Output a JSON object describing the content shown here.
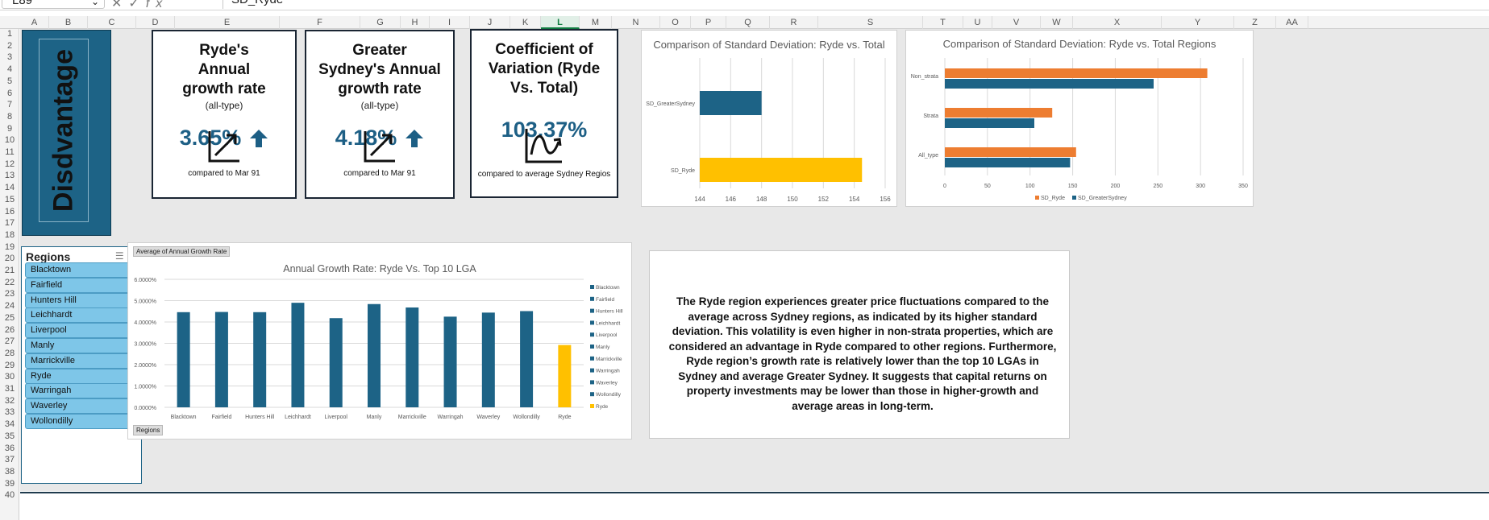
{
  "formula_bar": {
    "name_box": "L89",
    "fx": "fx",
    "formula": "SD_Ryde"
  },
  "columns": [
    "A",
    "B",
    "C",
    "D",
    "E",
    "F",
    "G",
    "H",
    "I",
    "J",
    "K",
    "L",
    "M",
    "N",
    "O",
    "P",
    "Q",
    "R",
    "S",
    "T",
    "U",
    "V",
    "W",
    "X",
    "Y",
    "Z",
    "AA"
  ],
  "active_column": "L",
  "rows": [
    "1",
    "2",
    "3",
    "4",
    "5",
    "6",
    "7",
    "8",
    "9",
    "10",
    "11",
    "12",
    "13",
    "14",
    "15",
    "16",
    "17",
    "18",
    "19",
    "20",
    "21",
    "22",
    "23",
    "24",
    "25",
    "26",
    "27",
    "28",
    "29",
    "30",
    "31",
    "32",
    "33",
    "34",
    "35",
    "36",
    "37",
    "38",
    "39",
    "40"
  ],
  "banner": {
    "text": "Disdvantage"
  },
  "cards": [
    {
      "title": "Ryde's Annual growth rate",
      "subtitle": "(all-type)",
      "value": "3.65%",
      "caption": "compared to Mar 91",
      "icon": "trend-up-icon",
      "arrow": "arrow-up-icon"
    },
    {
      "title": "Greater Sydney's Annual growth rate",
      "subtitle": "(all-type)",
      "value": "4.18%",
      "caption": "compared to Mar 91",
      "icon": "trend-up-icon",
      "arrow": "arrow-up-icon"
    },
    {
      "title": "Coefficient of Variation (Ryde Vs. Total)",
      "subtitle": "",
      "value": "103.37%",
      "caption": "compared to average Sydney Regios",
      "icon": "wave-chart-icon"
    }
  ],
  "slicer": {
    "title": "Regions",
    "items": [
      "Blacktown",
      "Fairfield",
      "Hunters Hill",
      "Leichhardt",
      "Liverpool",
      "Manly",
      "Marrickville",
      "Ryde",
      "Warringah",
      "Waverley",
      "Wollondilly"
    ]
  },
  "note": {
    "text": "The Ryde region experiences greater price fluctuations compared to the average across Sydney regions, as indicated by its higher standard deviation. This volatility is even higher in non-strata properties, which are considered an advantage in Ryde compared to other regions. Furthermore, Ryde region’s growth rate is relatively lower than the top 10 LGAs in Sydney and average Greater Sydney. It suggests that capital returns on property investments may be lower than those in higher-growth and average areas in long-term."
  },
  "colors": {
    "blue": "#1d6386",
    "gold": "#ffc000",
    "orange": "#ed7d31"
  },
  "chart_data": [
    {
      "type": "bar",
      "orientation": "horizontal",
      "title": "Comparison of Standard Deviation: Ryde vs. Total",
      "categories": [
        "SD_Ryde",
        "SD_GreaterSydney"
      ],
      "values": [
        154.5,
        148
      ],
      "xlim": [
        144,
        156
      ],
      "xticks": [
        "144",
        "146",
        "148",
        "150",
        "152",
        "154",
        "156"
      ],
      "grid": true
    },
    {
      "type": "bar",
      "orientation": "horizontal",
      "title": "Comparison of Standard Deviation: Ryde vs. Total Regions",
      "categories": [
        "All_type",
        "Strata",
        "Non_strata"
      ],
      "series": [
        {
          "name": "SD_Ryde",
          "values": [
            154,
            126,
            308
          ]
        },
        {
          "name": "SD_GreaterSydney",
          "values": [
            147,
            105,
            245
          ]
        }
      ],
      "xlim": [
        0,
        350
      ],
      "xticks": [
        "0",
        "50",
        "100",
        "150",
        "200",
        "250",
        "300",
        "350"
      ],
      "legend": "bottom",
      "grid": true
    },
    {
      "type": "bar",
      "title": "Annual Growth Rate: Ryde Vs. Top 10 LGA",
      "field_button": "Average of Annual Growth Rate",
      "axis_button": "Regions",
      "categories": [
        "Blacktown",
        "Fairfield",
        "Hunters Hill",
        "Leichhardt",
        "Liverpool",
        "Manly",
        "Marrickville",
        "Warringah",
        "Waverley",
        "Wollondilly",
        "Ryde"
      ],
      "values": [
        0.0446,
        0.0447,
        0.0446,
        0.049,
        0.0418,
        0.0484,
        0.0468,
        0.0425,
        0.0444,
        0.0451,
        0.0292
      ],
      "ylim": [
        0,
        0.06
      ],
      "yticks": [
        "0.0000%",
        "1.0000%",
        "2.0000%",
        "3.0000%",
        "4.0000%",
        "5.0000%",
        "6.0000%"
      ],
      "legend": "right",
      "grid": true
    }
  ]
}
